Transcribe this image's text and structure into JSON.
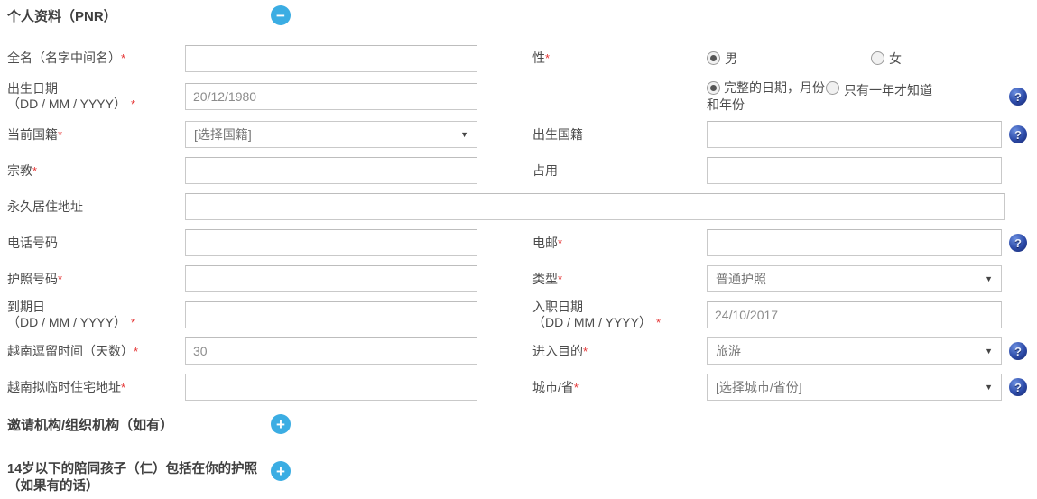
{
  "icons": {
    "collapse_glyph": "−",
    "expand_glyph": "+",
    "help_glyph": "?"
  },
  "marks": {
    "required": "*"
  },
  "colors": {
    "accent_blue": "#3badE3",
    "help_navy": "#2c4aa8",
    "required_red": "#e53535",
    "label_grey": "#4c4c4c",
    "value_grey": "#8c8c8c"
  },
  "personal": {
    "title": "个人资料（PNR）",
    "full_name_label": "全名（名字中间名）",
    "gender_label": "性",
    "gender_male_label": "男",
    "gender_female_label": "女",
    "gender_selected": "男",
    "dob_label": "出生日期",
    "dob_format": "（DD / MM / YYYY）",
    "dob_value": "20/12/1980",
    "dob_mode_full_label": "完整的日期，月份和年份",
    "dob_mode_year_label": "只有一年才知道",
    "dob_mode_selected": "完整的日期，月份和年份",
    "current_nationality_label": "当前国籍",
    "current_nationality_value": "[选择国籍]",
    "birth_nationality_label": "出生国籍",
    "religion_label": "宗教",
    "occupation_label": "占用",
    "permanent_address_label": "永久居住地址",
    "phone_label": "电话号码",
    "email_label": "电邮",
    "passport_no_label": "护照号码",
    "passport_type_label": "类型",
    "passport_type_value": "普通护照",
    "expiry_label": "到期日",
    "expiry_format": "（DD / MM / YYYY）",
    "entry_date_label": "入职日期",
    "entry_date_format": "（DD / MM / YYYY）",
    "entry_date_value": "24/10/2017",
    "stay_days_label": "越南逗留时间（天数）",
    "stay_days_value": "30",
    "purpose_label": "进入目的",
    "purpose_value": "旅游",
    "temp_address_label": "越南拟临时住宅地址",
    "city_label": "城市/省",
    "city_value": "[选择城市/省份]"
  },
  "sections": {
    "inviting_org_title": "邀请机构/组织机构（如有）",
    "children_title": "14岁以下的陪同孩子（仁）包括在你的护照（如果有的话）"
  }
}
